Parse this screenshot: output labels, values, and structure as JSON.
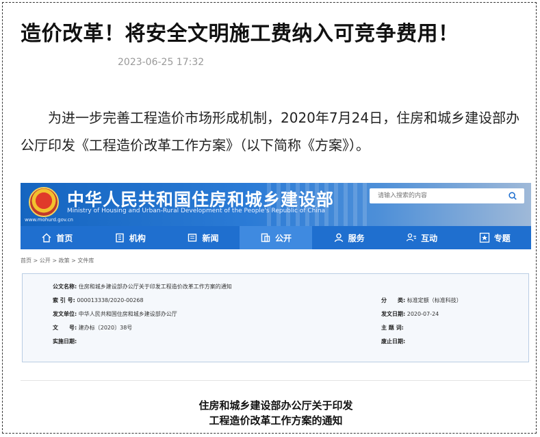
{
  "article": {
    "title": "造价改革！将安全文明施工费纳入可竞争费用！",
    "date": "2023-06-25 17:32",
    "paragraph": "为进一步完善工程造价市场形成机制，2020年7月24日，住房和城乡建设部办公厅印发《工程造价改革工作方案》（以下简称《方案》）。"
  },
  "site": {
    "name_cn": "中华人民共和国住房和城乡建设部",
    "name_en": "Ministry of Housing and Urban-Rural Development of the People's Republic of China",
    "url": "www.mohurd.gov.cn",
    "search_placeholder": "请输入搜索的内容",
    "colors": {
      "banner": "#1565c0",
      "nav": "#1f6fcf",
      "nav_active": "#3f8ae0"
    }
  },
  "nav": [
    {
      "label": "首页",
      "icon": "home-icon"
    },
    {
      "label": "机构",
      "icon": "building-icon"
    },
    {
      "label": "新闻",
      "icon": "news-icon"
    },
    {
      "label": "公开",
      "icon": "open-doc-icon"
    },
    {
      "label": "服务",
      "icon": "service-user-icon"
    },
    {
      "label": "互动",
      "icon": "interact-icon"
    },
    {
      "label": "专题",
      "icon": "star-icon"
    }
  ],
  "breadcrumb": "首页 > 公开 > 政策 > 文件库",
  "meta": {
    "doc_name_label": "公文名称:",
    "doc_name": "住房和城乡建设部办公厅关于印发工程造价改革工作方案的通知",
    "index_label": "索 引 号:",
    "index": "000013338/2020-00268",
    "category_label": "分　　类:",
    "category": "标准定额（标准科技）",
    "issuer_label": "发文单位:",
    "issuer": "中华人民共和国住房和城乡建设部办公厅",
    "issue_date_label": "发文日期:",
    "issue_date": "2020-07-24",
    "number_label": "文　　号:",
    "number": "建办标〔2020〕38号",
    "subject_label": "主 题 词:",
    "subject": "",
    "effective_label": "实施日期:",
    "effective": "",
    "expire_label": "废止日期:",
    "expire": ""
  },
  "doc_title": {
    "line1": "住房和城乡建设部办公厅关于印发",
    "line2": "工程造价改革工作方案的通知"
  }
}
